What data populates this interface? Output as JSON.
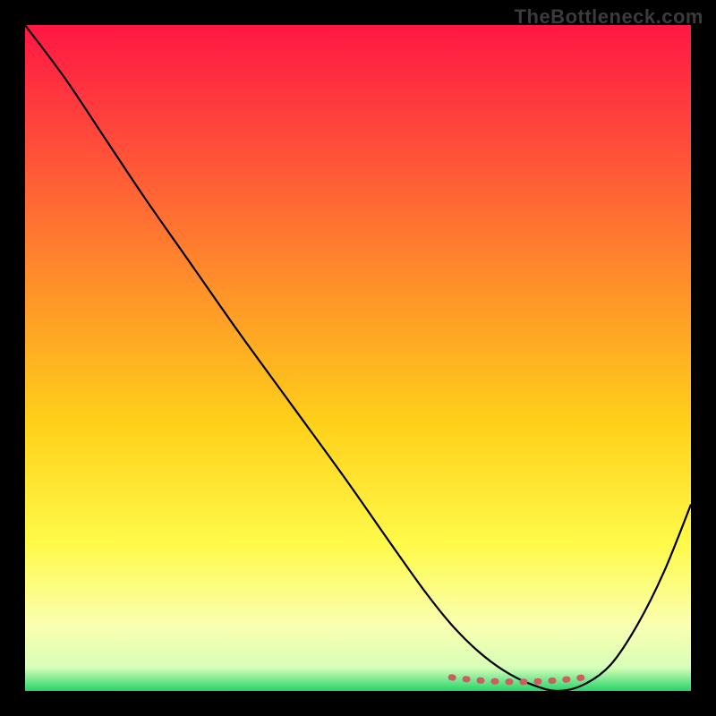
{
  "watermark": "TheBottleneck.com",
  "chart_data": {
    "type": "line",
    "title": "",
    "xlabel": "",
    "ylabel": "",
    "xlim": [
      0,
      100
    ],
    "ylim": [
      0,
      100
    ],
    "grid": false,
    "legend": false,
    "series": [
      {
        "name": "bottleneck-curve",
        "x": [
          0,
          6,
          12,
          18,
          25,
          32,
          40,
          48,
          55,
          60,
          64,
          68,
          72,
          76,
          80,
          84,
          88,
          92,
          96,
          100
        ],
        "values": [
          100,
          92,
          83,
          74,
          64,
          54,
          43,
          32,
          22,
          15,
          10,
          6,
          3,
          1,
          0,
          1,
          4,
          10,
          18,
          28
        ]
      }
    ],
    "annotations": [
      {
        "name": "optimal-range-dotted",
        "kind": "segment",
        "x_range": [
          64,
          84
        ],
        "y": 1.5,
        "color": "#cb5e5e",
        "style": "dotted"
      }
    ],
    "background_gradient_stops": [
      {
        "offset": 0.0,
        "color": "#FF1744"
      },
      {
        "offset": 0.18,
        "color": "#FF4D3A"
      },
      {
        "offset": 0.4,
        "color": "#FF9329"
      },
      {
        "offset": 0.6,
        "color": "#FFD11A"
      },
      {
        "offset": 0.78,
        "color": "#FFFA4A"
      },
      {
        "offset": 0.9,
        "color": "#FAFFB0"
      },
      {
        "offset": 0.965,
        "color": "#D7FFB8"
      },
      {
        "offset": 1.0,
        "color": "#26D36B"
      }
    ]
  }
}
